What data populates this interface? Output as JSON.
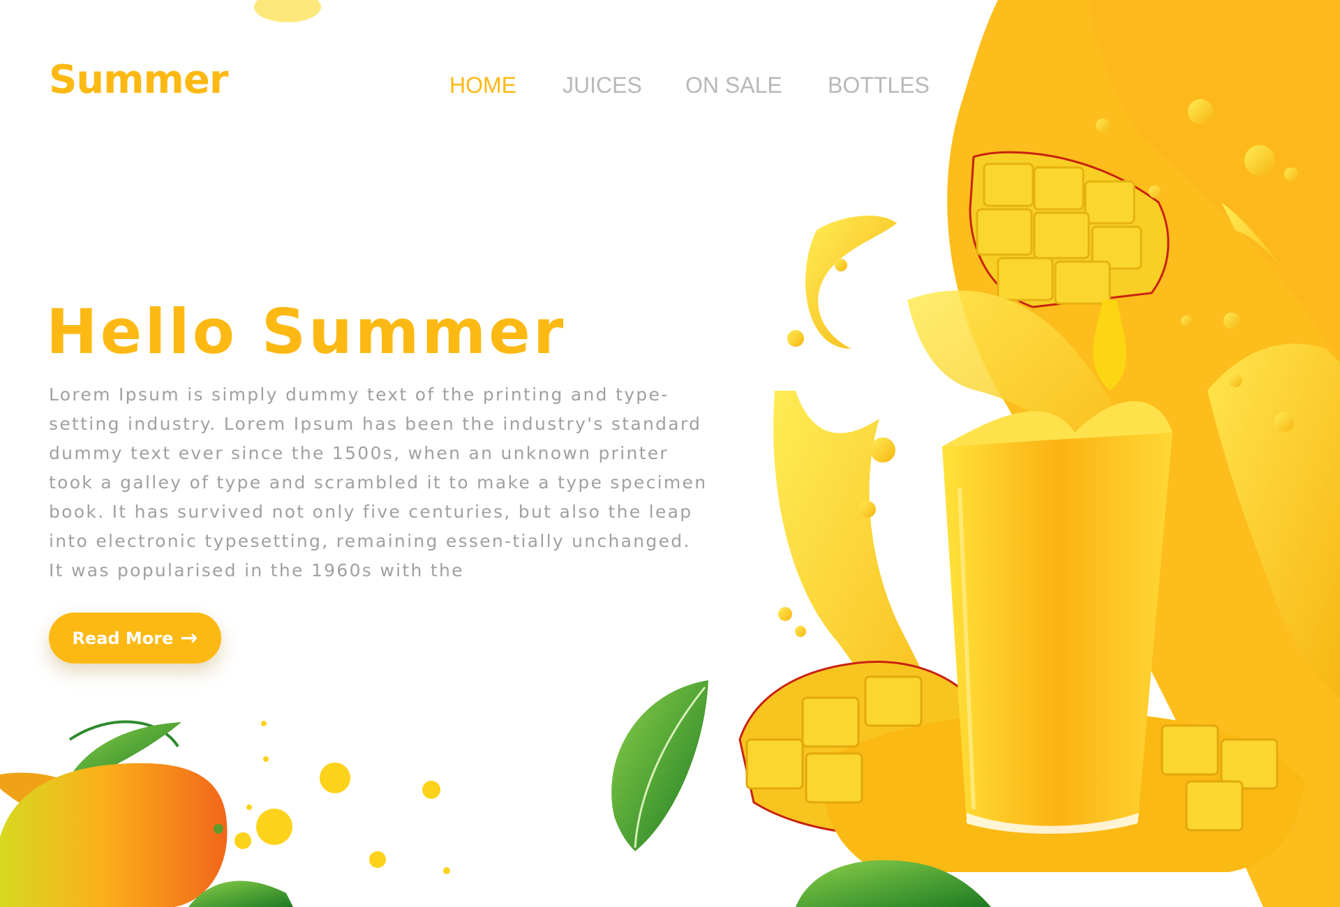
{
  "brand": {
    "name": "Summer"
  },
  "nav": {
    "items": [
      {
        "label": "HOME",
        "active": true
      },
      {
        "label": "JUICES",
        "active": false
      },
      {
        "label": "ON SALE",
        "active": false
      },
      {
        "label": "BOTTLES",
        "active": false
      }
    ]
  },
  "hero": {
    "title": "Hello Summer",
    "body": "Lorem Ipsum is simply dummy text of the printing and type-setting industry. Lorem Ipsum has been the industry's standard dummy text ever since the 1500s, when an unknown printer took a galley of type and scrambled it to make a type specimen book. It has survived not only five centuries, but also the leap into electronic typesetting, remaining essen-tially unchanged. It was popularised in the 1960s with the",
    "button_label": "Read More",
    "button_icon": "arrow-right-icon"
  },
  "colors": {
    "accent": "#fdb913",
    "nav_inactive": "#b8b8b8",
    "body_text": "#a0a0a0",
    "background_shape": "#fdbd1c"
  }
}
